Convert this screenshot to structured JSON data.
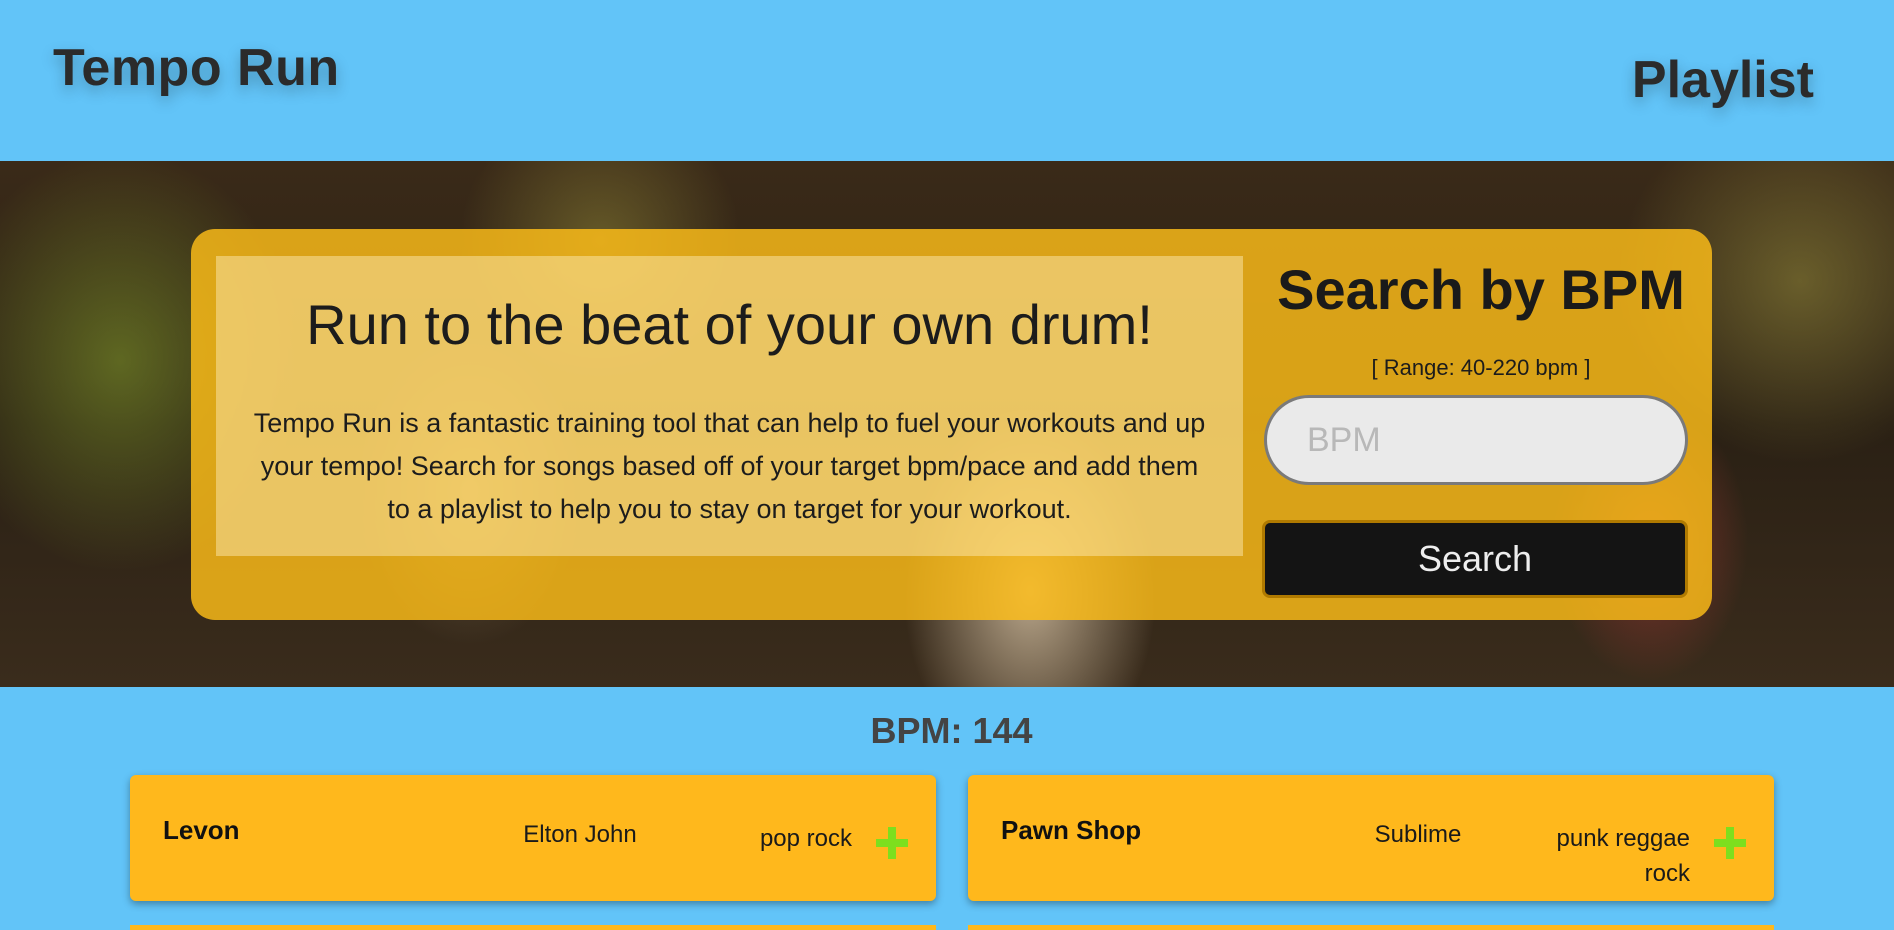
{
  "header": {
    "brand": "Tempo Run",
    "nav_playlist": "Playlist"
  },
  "hero": {
    "title": "Run to the beat of your own drum!",
    "description": "Tempo Run is a fantastic training tool that can help to fuel your workouts and up your tempo! Search for songs based off of your target bpm/pace and add them to a playlist to help you to stay on target for your workout.",
    "search_title": "Search by BPM",
    "range_note": "[ Range: 40-220 bpm ]",
    "input_placeholder": "BPM",
    "input_value": "",
    "search_button": "Search"
  },
  "results": {
    "bpm_label": "BPM: 144",
    "songs": [
      {
        "title": "Levon",
        "artist": "Elton John",
        "genre": "pop rock"
      },
      {
        "title": "Pawn Shop",
        "artist": "Sublime",
        "genre": "punk reggae rock"
      }
    ]
  },
  "colors": {
    "page_bg": "#62c4f8",
    "card_accent": "#ffb81c",
    "add_icon": "#7ddf1e",
    "button_bg": "#141414"
  },
  "icons": {
    "add": "plus-icon"
  }
}
